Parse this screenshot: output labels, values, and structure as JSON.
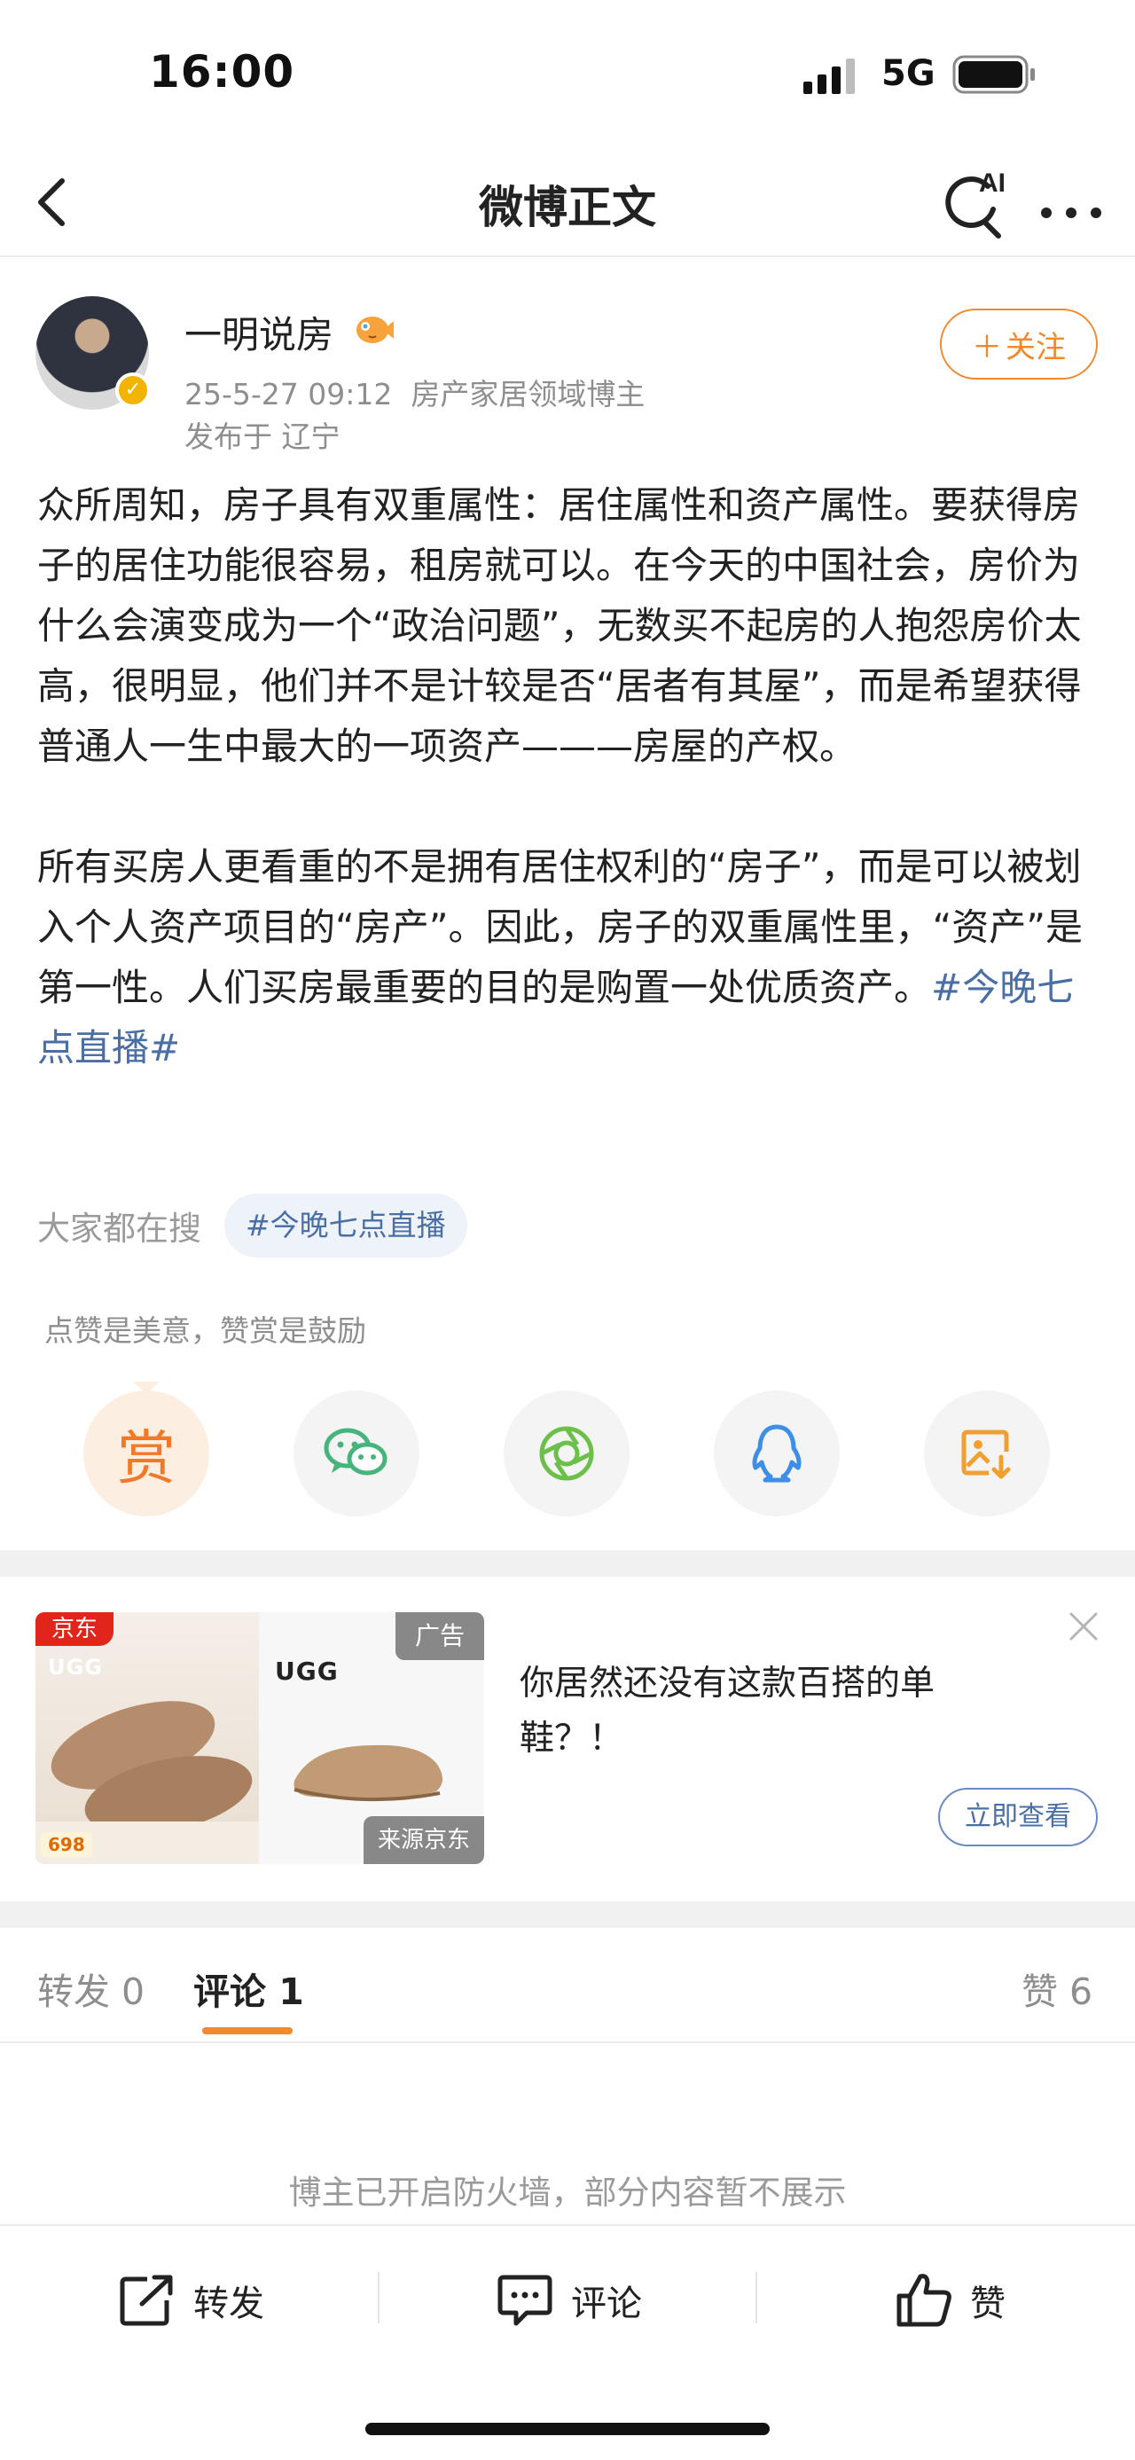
{
  "status_bar": {
    "time": "16:00",
    "network": "5G"
  },
  "nav": {
    "title": "微博正文",
    "ai_label": "AI"
  },
  "author": {
    "name": "一明说房",
    "timestamp": "25-5-27 09:12",
    "tag": "房产家居领域博主",
    "location": "发布于 辽宁",
    "follow_label": "关注"
  },
  "post": {
    "paragraph1": "众所周知，房子具有双重属性：居住属性和资产属性。要获得房子的居住功能很容易，租房就可以。在今天的中国社会，房价为什么会演变成为一个“政治问题”，无数买不起房的人抱怨房价太高，很明显，他们并不是计较是否“居者有其屋”，而是希望获得普通人一生中最大的一项资产———房屋的产权。",
    "paragraph2": "所有买房人更看重的不是拥有居住权利的“房子”，而是可以被划入个人资产项目的“房产”。因此，房子的双重属性里，“资产”是第一性。人们买房最重要的目的是购置一处优质资产。",
    "hashtag": "#今晚七点直播#"
  },
  "hot_search": {
    "label": "大家都在搜",
    "chip": "#今晚七点直播"
  },
  "reward": {
    "tip": "点赞是美意，赞赏是鼓励",
    "reward_char": "赏"
  },
  "ad": {
    "jd_label": "京东",
    "ad_tag": "广告",
    "source": "来源京东",
    "brand": "UGG",
    "price": "698",
    "text": "你居然还没有这款百搭的单鞋？！",
    "cta": "立即查看"
  },
  "tabs": {
    "repost": "转发 0",
    "comment": "评论 1",
    "like": "赞 6"
  },
  "firewall_notice": "博主已开启防火墙，部分内容暂不展示",
  "actions": {
    "repost": "转发",
    "comment": "评论",
    "like": "赞"
  },
  "colors": {
    "accent_orange": "#f08a2c",
    "link_blue": "#4a6fa5",
    "wechat_green": "#46b47b",
    "moments_green": "#6cc04a",
    "qq_blue": "#3d8ee6",
    "save_orange": "#f0a030"
  },
  "icons": [
    "back-icon",
    "ai-search-icon",
    "more-icon",
    "verified-icon",
    "fan-badge-icon",
    "wechat-icon",
    "moments-icon",
    "qq-icon",
    "save-image-icon",
    "close-icon",
    "repost-icon",
    "comment-icon",
    "like-icon"
  ]
}
